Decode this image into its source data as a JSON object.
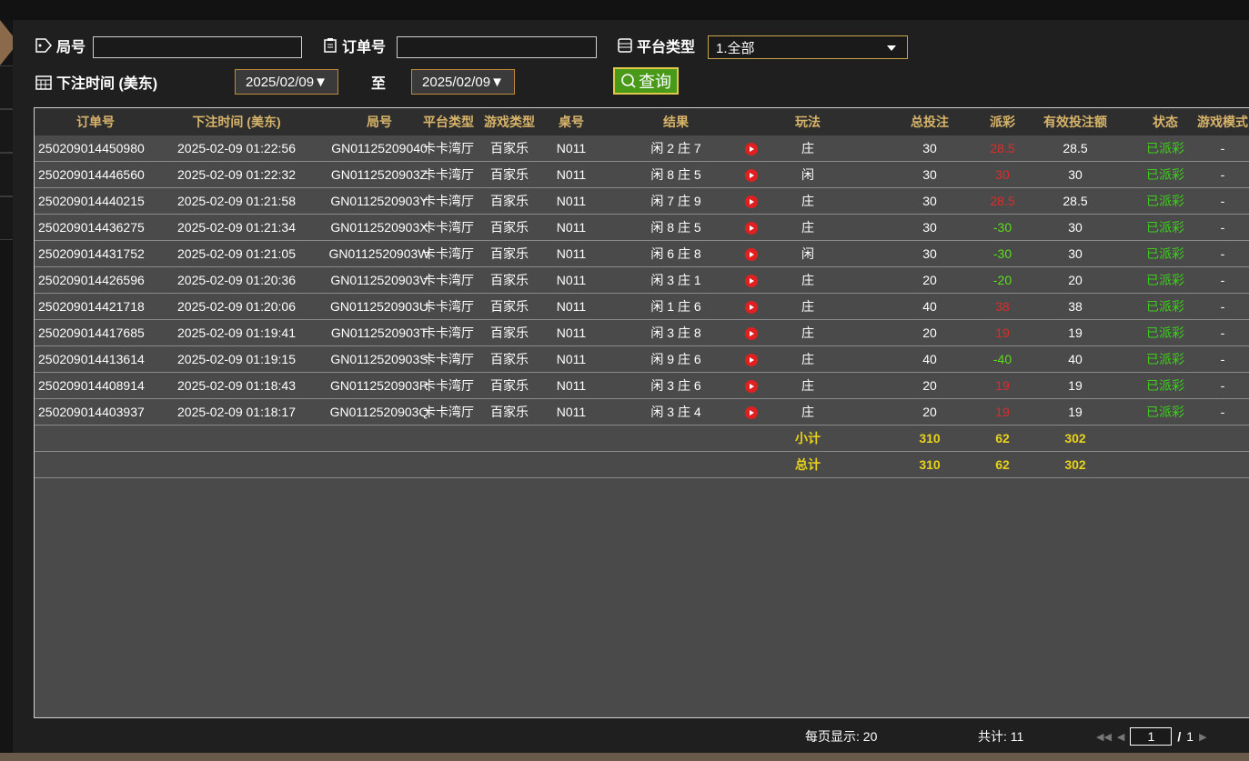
{
  "filters": {
    "round_label": "局号",
    "round_value": "",
    "order_label": "订单号",
    "order_value": "",
    "platform_label": "平台类型",
    "platform_selected": "1.全部",
    "time_label": "下注时间 (美东)",
    "date_from": "2025/02/09▼",
    "to_label": "至",
    "date_to": "2025/02/09▼",
    "query_label": "查询"
  },
  "table": {
    "headers": [
      "订单号",
      "下注时间 (美东)",
      "局号",
      "平台类型",
      "游戏类型",
      "桌号",
      "结果",
      "",
      "玩法",
      "总投注",
      "派彩",
      "有效投注额",
      "状态",
      "游戏模式"
    ],
    "rows": [
      {
        "order": "250209014450980",
        "time": "2025-02-09 01:22:56",
        "round": "GN01125209040",
        "platform": "卡卡湾厅",
        "game": "百家乐",
        "table": "N011",
        "result": "闲 2 庄 7",
        "play": "庄",
        "bet": "30",
        "payout": "28.5",
        "payout_color": "#e02a2a",
        "valid": "28.5",
        "status": "已派彩",
        "mode": "-"
      },
      {
        "order": "250209014446560",
        "time": "2025-02-09 01:22:32",
        "round": "GN0112520903Z",
        "platform": "卡卡湾厅",
        "game": "百家乐",
        "table": "N011",
        "result": "闲 8 庄 5",
        "play": "闲",
        "bet": "30",
        "payout": "30",
        "payout_color": "#e02a2a",
        "valid": "30",
        "status": "已派彩",
        "mode": "-"
      },
      {
        "order": "250209014440215",
        "time": "2025-02-09 01:21:58",
        "round": "GN0112520903Y",
        "platform": "卡卡湾厅",
        "game": "百家乐",
        "table": "N011",
        "result": "闲 7 庄 9",
        "play": "庄",
        "bet": "30",
        "payout": "28.5",
        "payout_color": "#e02a2a",
        "valid": "28.5",
        "status": "已派彩",
        "mode": "-"
      },
      {
        "order": "250209014436275",
        "time": "2025-02-09 01:21:34",
        "round": "GN0112520903X",
        "platform": "卡卡湾厅",
        "game": "百家乐",
        "table": "N011",
        "result": "闲 8 庄 5",
        "play": "庄",
        "bet": "30",
        "payout": "-30",
        "payout_color": "#5adf1a",
        "valid": "30",
        "status": "已派彩",
        "mode": "-"
      },
      {
        "order": "250209014431752",
        "time": "2025-02-09 01:21:05",
        "round": "GN0112520903W",
        "platform": "卡卡湾厅",
        "game": "百家乐",
        "table": "N011",
        "result": "闲 6 庄 8",
        "play": "闲",
        "bet": "30",
        "payout": "-30",
        "payout_color": "#5adf1a",
        "valid": "30",
        "status": "已派彩",
        "mode": "-"
      },
      {
        "order": "250209014426596",
        "time": "2025-02-09 01:20:36",
        "round": "GN0112520903V",
        "platform": "卡卡湾厅",
        "game": "百家乐",
        "table": "N011",
        "result": "闲 3 庄 1",
        "play": "庄",
        "bet": "20",
        "payout": "-20",
        "payout_color": "#5adf1a",
        "valid": "20",
        "status": "已派彩",
        "mode": "-"
      },
      {
        "order": "250209014421718",
        "time": "2025-02-09 01:20:06",
        "round": "GN0112520903U",
        "platform": "卡卡湾厅",
        "game": "百家乐",
        "table": "N011",
        "result": "闲 1 庄 6",
        "play": "庄",
        "bet": "40",
        "payout": "38",
        "payout_color": "#e02a2a",
        "valid": "38",
        "status": "已派彩",
        "mode": "-"
      },
      {
        "order": "250209014417685",
        "time": "2025-02-09 01:19:41",
        "round": "GN0112520903T",
        "platform": "卡卡湾厅",
        "game": "百家乐",
        "table": "N011",
        "result": "闲 3 庄 8",
        "play": "庄",
        "bet": "20",
        "payout": "19",
        "payout_color": "#e02a2a",
        "valid": "19",
        "status": "已派彩",
        "mode": "-"
      },
      {
        "order": "250209014413614",
        "time": "2025-02-09 01:19:15",
        "round": "GN0112520903S",
        "platform": "卡卡湾厅",
        "game": "百家乐",
        "table": "N011",
        "result": "闲 9 庄 6",
        "play": "庄",
        "bet": "40",
        "payout": "-40",
        "payout_color": "#5adf1a",
        "valid": "40",
        "status": "已派彩",
        "mode": "-"
      },
      {
        "order": "250209014408914",
        "time": "2025-02-09 01:18:43",
        "round": "GN0112520903R",
        "platform": "卡卡湾厅",
        "game": "百家乐",
        "table": "N011",
        "result": "闲 3 庄 6",
        "play": "庄",
        "bet": "20",
        "payout": "19",
        "payout_color": "#e02a2a",
        "valid": "19",
        "status": "已派彩",
        "mode": "-"
      },
      {
        "order": "250209014403937",
        "time": "2025-02-09 01:18:17",
        "round": "GN0112520903Q",
        "platform": "卡卡湾厅",
        "game": "百家乐",
        "table": "N011",
        "result": "闲 3 庄 4",
        "play": "庄",
        "bet": "20",
        "payout": "19",
        "payout_color": "#e02a2a",
        "valid": "19",
        "status": "已派彩",
        "mode": "-"
      }
    ],
    "subtotal": {
      "label": "小计",
      "bet": "310",
      "payout": "62",
      "valid": "302"
    },
    "total": {
      "label": "总计",
      "bet": "310",
      "payout": "62",
      "valid": "302"
    }
  },
  "footer": {
    "per_page": "每页显示: 20",
    "total_count": "共计: 11",
    "current_page": "1",
    "separator": "/",
    "page_count": "1"
  },
  "colors": {
    "header_text": "#d8b46a",
    "status_text": "#3ccf1a",
    "summary_text": "#e8d21a",
    "query_button": "#4a9a1a"
  }
}
